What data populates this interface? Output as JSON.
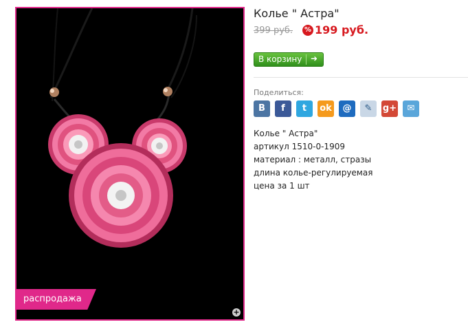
{
  "product": {
    "title": "Колье \" Астра\"",
    "old_price": "399 руб.",
    "discount_icon": "%",
    "new_price": "199 руб."
  },
  "image": {
    "sale_label": "распродажа",
    "zoom_icon": "plus-icon",
    "frame_color": "#e0288a"
  },
  "cart": {
    "label": "В корзину",
    "icon": "arrow-right-icon"
  },
  "share": {
    "label": "Поделиться:",
    "icons": [
      {
        "name": "vkontakte-icon",
        "glyph": "B",
        "color": "#4c75a3"
      },
      {
        "name": "facebook-icon",
        "glyph": "f",
        "color": "#3b5998"
      },
      {
        "name": "twitter-icon",
        "glyph": "t",
        "color": "#2fa7e0"
      },
      {
        "name": "odnoklassniki-icon",
        "glyph": "ok",
        "color": "#f59a1d"
      },
      {
        "name": "mail-agent-icon",
        "glyph": "@",
        "color": "#1e6bbf"
      },
      {
        "name": "livejournal-icon",
        "glyph": "✎",
        "color": "#c9d7e6"
      },
      {
        "name": "google-plus-icon",
        "glyph": "g+",
        "color": "#d34836"
      },
      {
        "name": "email-icon",
        "glyph": "✉",
        "color": "#5aa6da"
      }
    ]
  },
  "description": {
    "lines": [
      "Колье \" Астра\"",
      "артикул 1510-0-1909",
      "материал : металл, стразы",
      "длина колье-регулируемая",
      "цена за 1 шт"
    ]
  }
}
